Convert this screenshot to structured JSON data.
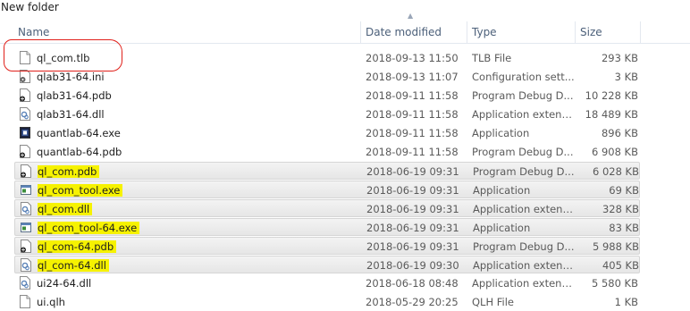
{
  "window": {
    "title": "New folder"
  },
  "columns": {
    "name": "Name",
    "date": "Date modified",
    "type": "Type",
    "size": "Size"
  },
  "files": [
    {
      "name": "ql_com.tlb",
      "date": "2018-09-13 11:50",
      "type": "TLB File",
      "size": "293 KB",
      "icon": "blank-file-icon",
      "highlighted": false,
      "circled": true,
      "selected": false
    },
    {
      "name": "qlab31-64.ini",
      "date": "2018-09-13 11:07",
      "type": "Configuration sett...",
      "size": "3 KB",
      "icon": "settings-file-icon",
      "highlighted": false,
      "circled": false,
      "selected": false
    },
    {
      "name": "qlab31-64.pdb",
      "date": "2018-09-11 11:58",
      "type": "Program Debug D...",
      "size": "10 228 KB",
      "icon": "pdb-file-icon",
      "highlighted": false,
      "circled": false,
      "selected": false
    },
    {
      "name": "qlab31-64.dll",
      "date": "2018-09-11 11:58",
      "type": "Application extens...",
      "size": "18 489 KB",
      "icon": "dll-file-icon",
      "highlighted": false,
      "circled": false,
      "selected": false
    },
    {
      "name": "quantlab-64.exe",
      "date": "2018-09-11 11:58",
      "type": "Application",
      "size": "896 KB",
      "icon": "app-exe-icon",
      "highlighted": false,
      "circled": false,
      "selected": false
    },
    {
      "name": "quantlab-64.pdb",
      "date": "2018-09-11 11:58",
      "type": "Program Debug D...",
      "size": "6 908 KB",
      "icon": "pdb-file-icon",
      "highlighted": false,
      "circled": false,
      "selected": false
    },
    {
      "name": "ql_com.pdb",
      "date": "2018-06-19 09:31",
      "type": "Program Debug D...",
      "size": "6 028 KB",
      "icon": "pdb-file-icon",
      "highlighted": true,
      "circled": false,
      "selected": true
    },
    {
      "name": "ql_com_tool.exe",
      "date": "2018-06-19 09:31",
      "type": "Application",
      "size": "69 KB",
      "icon": "window-exe-icon",
      "highlighted": true,
      "circled": false,
      "selected": true
    },
    {
      "name": "ql_com.dll",
      "date": "2018-06-19 09:31",
      "type": "Application extens...",
      "size": "328 KB",
      "icon": "dll-file-icon",
      "highlighted": true,
      "circled": false,
      "selected": true
    },
    {
      "name": "ql_com_tool-64.exe",
      "date": "2018-06-19 09:31",
      "type": "Application",
      "size": "83 KB",
      "icon": "window-exe-icon",
      "highlighted": true,
      "circled": false,
      "selected": true
    },
    {
      "name": "ql_com-64.pdb",
      "date": "2018-06-19 09:31",
      "type": "Program Debug D...",
      "size": "5 988 KB",
      "icon": "pdb-file-icon",
      "highlighted": true,
      "circled": false,
      "selected": true
    },
    {
      "name": "ql_com-64.dll",
      "date": "2018-06-19 09:30",
      "type": "Application extens...",
      "size": "405 KB",
      "icon": "dll-file-icon",
      "highlighted": true,
      "circled": false,
      "selected": true
    },
    {
      "name": "ui24-64.dll",
      "date": "2018-06-18 08:48",
      "type": "Application extens...",
      "size": "5 580 KB",
      "icon": "dll-file-icon",
      "highlighted": false,
      "circled": false,
      "selected": false
    },
    {
      "name": "ui.qlh",
      "date": "2018-05-29 20:25",
      "type": "QLH File",
      "size": "1 KB",
      "icon": "blank-file-icon",
      "highlighted": false,
      "circled": false,
      "selected": false
    }
  ],
  "colors": {
    "highlight": "#f6f200",
    "annotation_circle": "#e0201a",
    "header_text": "#4c607a"
  }
}
